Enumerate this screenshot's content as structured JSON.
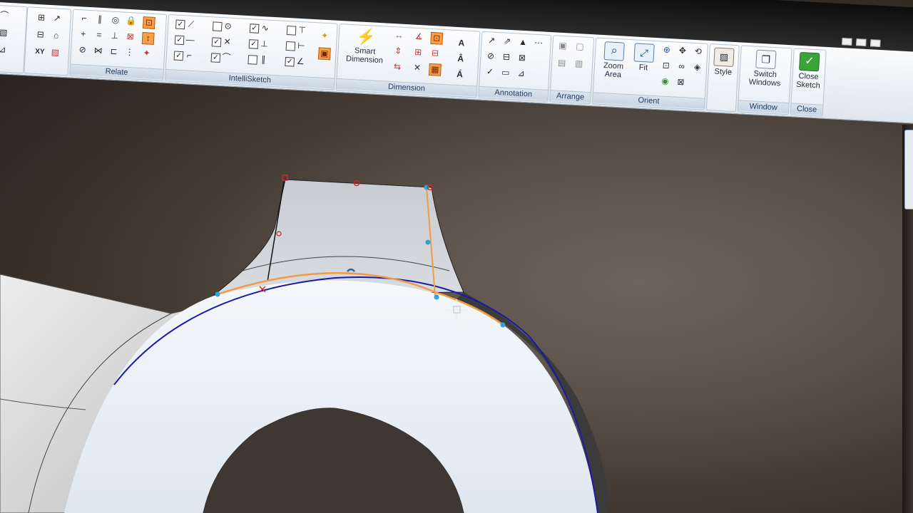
{
  "ribbon": {
    "groups": {
      "relate": {
        "label": "Relate"
      },
      "intellisketch": {
        "label": "IntelliSketch"
      },
      "dimension": {
        "label": "Dimension",
        "smart_dimension_label": "Smart Dimension"
      },
      "annotation": {
        "label": "Annotation"
      },
      "arrange": {
        "label": "Arrange"
      },
      "orient": {
        "label": "Orient",
        "zoom_area_label": "Zoom Area",
        "fit_label": "Fit"
      },
      "style": {
        "label": "Style"
      },
      "window": {
        "label": "Window",
        "switch_windows_label": "Switch Windows"
      },
      "close": {
        "label": "Close",
        "close_sketch_label": "Close Sketch"
      }
    },
    "relate_xy_label": "XY"
  },
  "colors": {
    "accent_orange": "#f29a45",
    "sketch_blue": "#1a1aa8",
    "handle_cyan": "#2ea3d8",
    "relation_red": "#d2232a",
    "close_green": "#3aa33a"
  },
  "icons": {
    "zoom_area": "magnifier-icon",
    "fit": "fit-icon",
    "close_sketch": "check-icon",
    "style": "style-icon",
    "switch_windows": "windows-icon",
    "smart_dimension": "lightning-dimension-icon"
  }
}
